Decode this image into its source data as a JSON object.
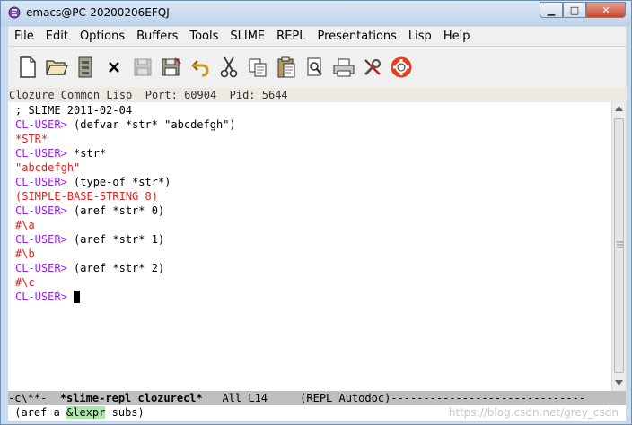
{
  "window": {
    "title": "emacs@PC-20200206EFQJ"
  },
  "menu": [
    "File",
    "Edit",
    "Options",
    "Buffers",
    "Tools",
    "SLIME",
    "REPL",
    "Presentations",
    "Lisp",
    "Help"
  ],
  "toolbar": [
    "new-file-icon",
    "open-folder-icon",
    "dired-icon",
    "close-x-icon",
    "save-disabled-icon",
    "save-icon",
    "undo-icon",
    "cut-icon",
    "copy-icon",
    "paste-icon",
    "search-icon",
    "print-icon",
    "preferences-icon",
    "help-lifebuoy-icon"
  ],
  "header_line": "Clozure Common Lisp  Port: 60904  Pid: 5644",
  "repl": [
    {
      "kind": "comment",
      "text": "; SLIME 2011-02-04"
    },
    {
      "kind": "prompt",
      "prompt": "CL-USER>",
      "text": " (defvar *str* \"abcdefgh\")"
    },
    {
      "kind": "result",
      "text": "*STR*"
    },
    {
      "kind": "prompt",
      "prompt": "CL-USER>",
      "text": " *str*"
    },
    {
      "kind": "result",
      "text": "\"abcdefgh\""
    },
    {
      "kind": "prompt",
      "prompt": "CL-USER>",
      "text": " (type-of *str*)"
    },
    {
      "kind": "result",
      "text": "(SIMPLE-BASE-STRING 8)"
    },
    {
      "kind": "prompt",
      "prompt": "CL-USER>",
      "text": " (aref *str* 0)"
    },
    {
      "kind": "result",
      "text": "#\\a"
    },
    {
      "kind": "prompt",
      "prompt": "CL-USER>",
      "text": " (aref *str* 1)"
    },
    {
      "kind": "result",
      "text": "#\\b"
    },
    {
      "kind": "prompt",
      "prompt": "CL-USER>",
      "text": " (aref *str* 2)"
    },
    {
      "kind": "result",
      "text": "#\\c"
    },
    {
      "kind": "prompt",
      "prompt": "CL-USER>",
      "text": " "
    }
  ],
  "modeline": {
    "status": "-c\\**-",
    "buffer": "*slime-repl clozurecl*",
    "position": "All L14",
    "modes": "(REPL Autodoc)"
  },
  "echo": {
    "pre": "(aref a ",
    "highlight": "&lexpr",
    "post": " subs)"
  },
  "watermark": "https://blog.csdn.net/grey_csdn"
}
